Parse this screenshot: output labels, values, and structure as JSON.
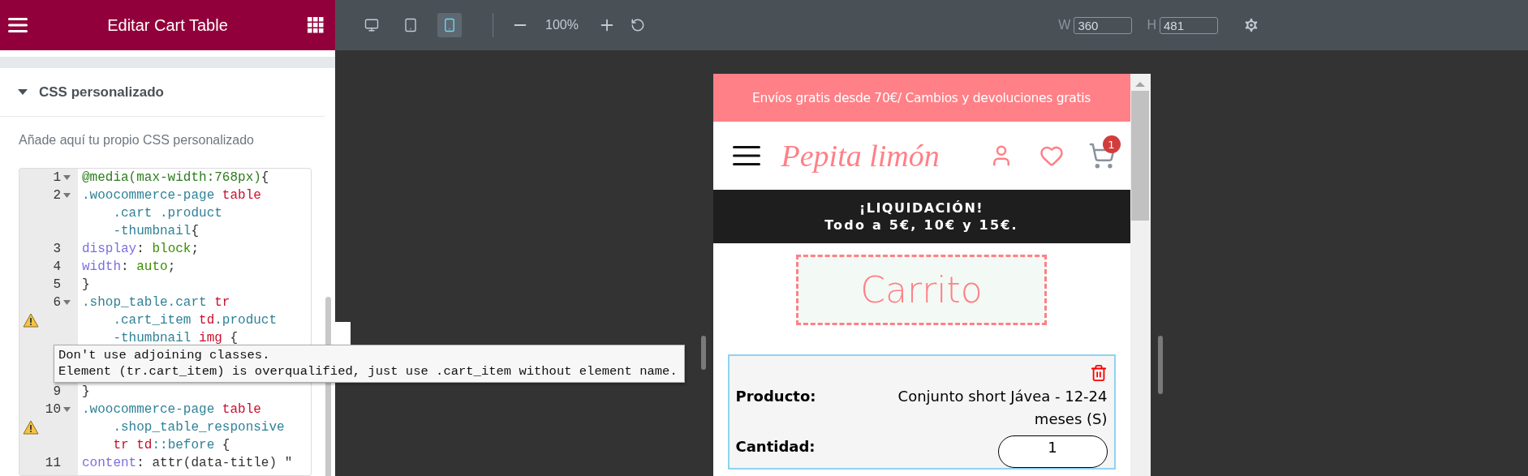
{
  "panel": {
    "title": "Editar Cart Table",
    "section": {
      "title": "CSS personalizado",
      "expanded": true
    },
    "description": "Añade aquí tu propio CSS personalizado",
    "code_lines": [
      {
        "number": "1",
        "foldable": true,
        "warning": false,
        "rows": [
          {
            "segments": [
              {
                "kind": "atrule",
                "text": "@media(max-width:768px)"
              },
              {
                "kind": "plain",
                "text": "{"
              }
            ]
          }
        ]
      },
      {
        "number": "2",
        "foldable": true,
        "warning": false,
        "rows": [
          {
            "segments": [
              {
                "kind": "selector",
                "text": ".woocommerce-page"
              },
              {
                "kind": "tag",
                "text": " table"
              }
            ]
          },
          {
            "segments": [
              {
                "kind": "selector",
                "text": ".cart .product"
              }
            ]
          },
          {
            "segments": [
              {
                "kind": "selector",
                "text": "-thumbnail"
              },
              {
                "kind": "plain",
                "text": "{"
              }
            ]
          }
        ]
      },
      {
        "number": "3",
        "foldable": false,
        "warning": false,
        "rows": [
          {
            "segments": [
              {
                "kind": "property",
                "text": "display"
              },
              {
                "kind": "plain",
                "text": ": "
              },
              {
                "kind": "value",
                "text": "block"
              },
              {
                "kind": "plain",
                "text": ";"
              }
            ]
          }
        ]
      },
      {
        "number": "4",
        "foldable": false,
        "warning": false,
        "rows": [
          {
            "segments": [
              {
                "kind": "property",
                "text": "width"
              },
              {
                "kind": "plain",
                "text": ": "
              },
              {
                "kind": "value",
                "text": "auto"
              },
              {
                "kind": "plain",
                "text": ";"
              }
            ]
          }
        ]
      },
      {
        "number": "5",
        "foldable": false,
        "warning": false,
        "rows": [
          {
            "segments": [
              {
                "kind": "plain",
                "text": "}"
              }
            ]
          }
        ]
      },
      {
        "number": "6",
        "foldable": true,
        "warning": true,
        "rows": [
          {
            "segments": [
              {
                "kind": "selector",
                "text": ".shop_table.cart"
              },
              {
                "kind": "tag",
                "text": " tr"
              }
            ]
          },
          {
            "segments": [
              {
                "kind": "selector",
                "text": ".cart_item"
              },
              {
                "kind": "tag",
                "text": " td"
              },
              {
                "kind": "selector",
                "text": ".product"
              }
            ]
          },
          {
            "segments": [
              {
                "kind": "selector",
                "text": "-thumbnail"
              },
              {
                "kind": "tag",
                "text": " img"
              },
              {
                "kind": "plain",
                "text": " {"
              }
            ]
          }
        ],
        "tooltip": [
          "Don't use adjoining classes.",
          "Element (tr.cart_item) is overqualified, just use .cart_item without element name."
        ]
      },
      {
        "number": "9",
        "foldable": false,
        "warning": false,
        "rows": [
          {
            "segments": [
              {
                "kind": "plain",
                "text": "}"
              }
            ]
          }
        ]
      },
      {
        "number": "10",
        "foldable": true,
        "warning": true,
        "rows": [
          {
            "segments": [
              {
                "kind": "selector",
                "text": ".woocommerce-page"
              },
              {
                "kind": "tag",
                "text": " table"
              }
            ]
          },
          {
            "segments": [
              {
                "kind": "selector",
                "text": ".shop_table_responsive"
              }
            ]
          },
          {
            "segments": [
              {
                "kind": "tag",
                "text": "tr td"
              },
              {
                "kind": "selector",
                "text": "::before"
              },
              {
                "kind": "plain",
                "text": " {"
              }
            ]
          }
        ]
      },
      {
        "number": "11",
        "foldable": false,
        "warning": false,
        "rows": [
          {
            "segments": [
              {
                "kind": "property",
                "text": "content"
              },
              {
                "kind": "plain",
                "text": ": attr(data-title) \""
              }
            ]
          }
        ]
      }
    ]
  },
  "toolbar": {
    "devices": [
      {
        "kind": "desktop",
        "selected": false
      },
      {
        "kind": "tablet",
        "selected": false
      },
      {
        "kind": "mobile",
        "selected": true
      }
    ],
    "zoom": "100%",
    "width": {
      "label": "W",
      "value": "360"
    },
    "height": {
      "label": "H",
      "value": "481"
    }
  },
  "preview": {
    "announcement": "Envíos gratis desde 70€/ Cambios y devoluciones gratis",
    "logo": "Pepita limón",
    "cart_count": "1",
    "promo": [
      "¡LIQUIDACIÓN!",
      "Todo a 5€, 10€ y 15€."
    ],
    "page_title": "Carrito",
    "cart_item": {
      "fields": [
        {
          "kind": "text",
          "label": "Producto:",
          "value": "Conjunto short Jávea - 12-24 meses (S)"
        },
        {
          "kind": "quantity",
          "label": "Cantidad:",
          "value": "1"
        }
      ]
    }
  }
}
